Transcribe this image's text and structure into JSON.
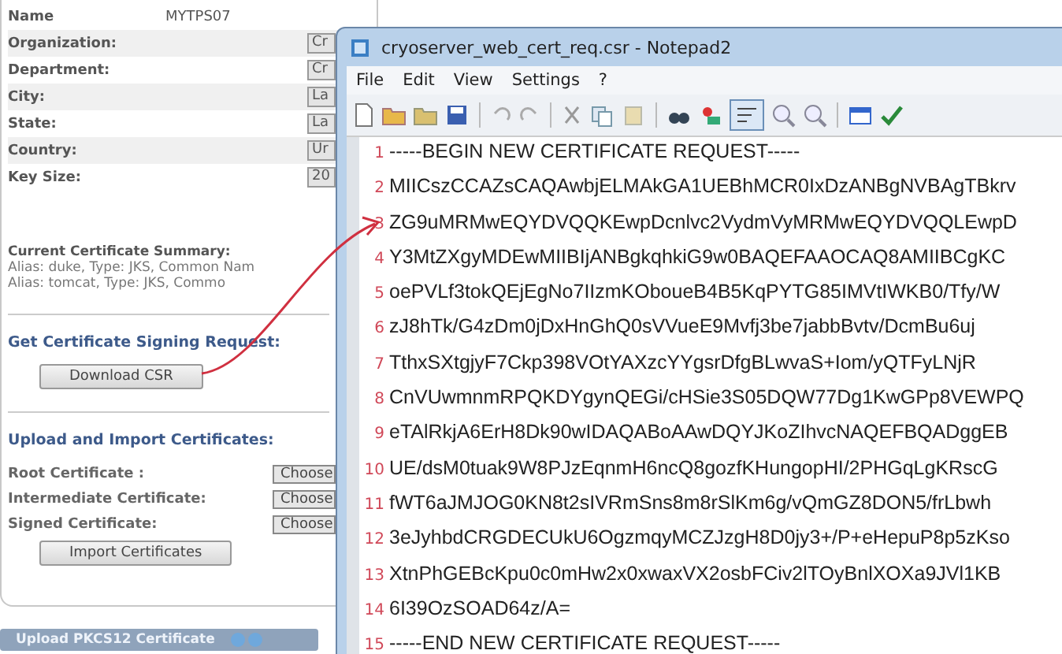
{
  "form": {
    "fields": [
      {
        "label": "Name",
        "value": "MYTPS07"
      },
      {
        "label": "Organization:",
        "value": "Cr"
      },
      {
        "label": "Department:",
        "value": "Cr"
      },
      {
        "label": "City:",
        "value": "La"
      },
      {
        "label": "State:",
        "value": "La"
      },
      {
        "label": "Country:",
        "value": "Ur"
      },
      {
        "label": "Key Size:",
        "value": "20"
      }
    ]
  },
  "summary": {
    "title": "Current Certificate Summary:",
    "lines": [
      "Alias: duke, Type: JKS, Common Nam",
      "Alias: tomcat, Type: JKS, Commo"
    ]
  },
  "csr": {
    "title": "Get Certificate Signing Request:",
    "button": "Download CSR"
  },
  "upload": {
    "title": "Upload and Import Certificates:",
    "rows": [
      {
        "label": "Root Certificate :",
        "button": "Choose"
      },
      {
        "label": "Intermediate Certificate:",
        "button": "Choose"
      },
      {
        "label": "Signed Certificate:",
        "button": "Choose"
      }
    ],
    "button": "Import Certificates"
  },
  "bottom_bar": {
    "title": "Upload PKCS12 Certificate"
  },
  "notepad": {
    "title": "cryoserver_web_cert_req.csr - Notepad2",
    "menu": [
      "File",
      "Edit",
      "View",
      "Settings",
      "?"
    ],
    "lines": [
      {
        "number": "1",
        "text": "-----BEGIN NEW CERTIFICATE REQUEST-----"
      },
      {
        "number": "2",
        "text": "MIICszCCAZsCAQAwbjELMAkGA1UEBhMCR0IxDzANBgNVBAgTBkrv"
      },
      {
        "number": "3",
        "text": "ZG9uMRMwEQYDVQQKEwpDcnlvc2VydmVyMRMwEQYDVQQLEwpD"
      },
      {
        "number": "4",
        "text": "Y3MtZXgyMDEwMIIBIjANBgkqhkiG9w0BAQEFAAOCAQ8AMIIBCgKC"
      },
      {
        "number": "5",
        "text": "oePVLf3tokQEjEgNo7IIzmKOboueB4B5KqPYTG85IMVtIWKB0/Tfy/W"
      },
      {
        "number": "6",
        "text": "zJ8hTk/G4zDm0jDxHnGhQ0sVVueE9Mvfj3be7jabbBvtv/DcmBu6uj"
      },
      {
        "number": "7",
        "text": "TthxSXtgjyF7Ckp398VOtYAXzcYYgsrDfgBLwvaS+Iom/yQTFyLNjR"
      },
      {
        "number": "8",
        "text": "CnVUwmnmRPQKDYgynQEGi/cHSie3S05DQW77Dg1KwGPp8VEWPQ"
      },
      {
        "number": "9",
        "text": "eTAlRkjA6ErH8Dk90wIDAQABoAAwDQYJKoZIhvcNAQEFBQADggEB"
      },
      {
        "number": "10",
        "text": "UE/dsM0tuak9W8PJzEqnmH6ncQ8gozfKHungopHI/2PHGqLgKRscG"
      },
      {
        "number": "11",
        "text": "fWT6aJMJOG0KN8t2sIVRmSns8m8rSlKm6g/vQmGZ8DON5/frLbwh"
      },
      {
        "number": "12",
        "text": "3eJyhbdCRGDECUkU6OgzmqyMCZJzgH8D0jy3+/P+eHepuP8p5zKso"
      },
      {
        "number": "13",
        "text": "XtnPhGEBcKpu0c0mHw2x0xwaxVX2osbFCiv2lTOyBnlXOXa9JVl1KB"
      },
      {
        "number": "14",
        "text": "6I39OzSOAD64z/A="
      },
      {
        "number": "15",
        "text": "-----END NEW CERTIFICATE REQUEST-----"
      }
    ]
  }
}
